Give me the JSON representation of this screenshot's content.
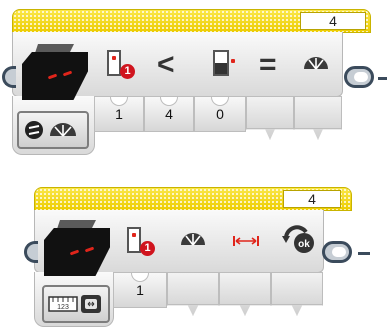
{
  "block_top": {
    "name": "color-sensor-compare-block",
    "count": "4",
    "operator_compare": "<",
    "operator_equals": "=",
    "port_badge": "1",
    "inputs": [
      "1",
      "4",
      "0"
    ]
  },
  "block_bottom": {
    "name": "color-sensor-calibrate-block",
    "count": "4",
    "port_badge": "1",
    "inputs": [
      "1"
    ]
  },
  "icons": {
    "sensor": "color-sensor-icon",
    "port": "port-selector-icon",
    "compare_port": "compare-port-icon",
    "gauge": "reflected-light-gauge-icon",
    "range": "min-max-range-icon",
    "reset": "reset-ok-icon",
    "mode_compare": "compare-reflected-mode-icon",
    "mode_calibrate": "calibrate-mode-icon"
  },
  "colors": {
    "header_yellow": "#f6de18",
    "badge_red": "#d0141e",
    "wire_dark": "#3b4b5c"
  }
}
